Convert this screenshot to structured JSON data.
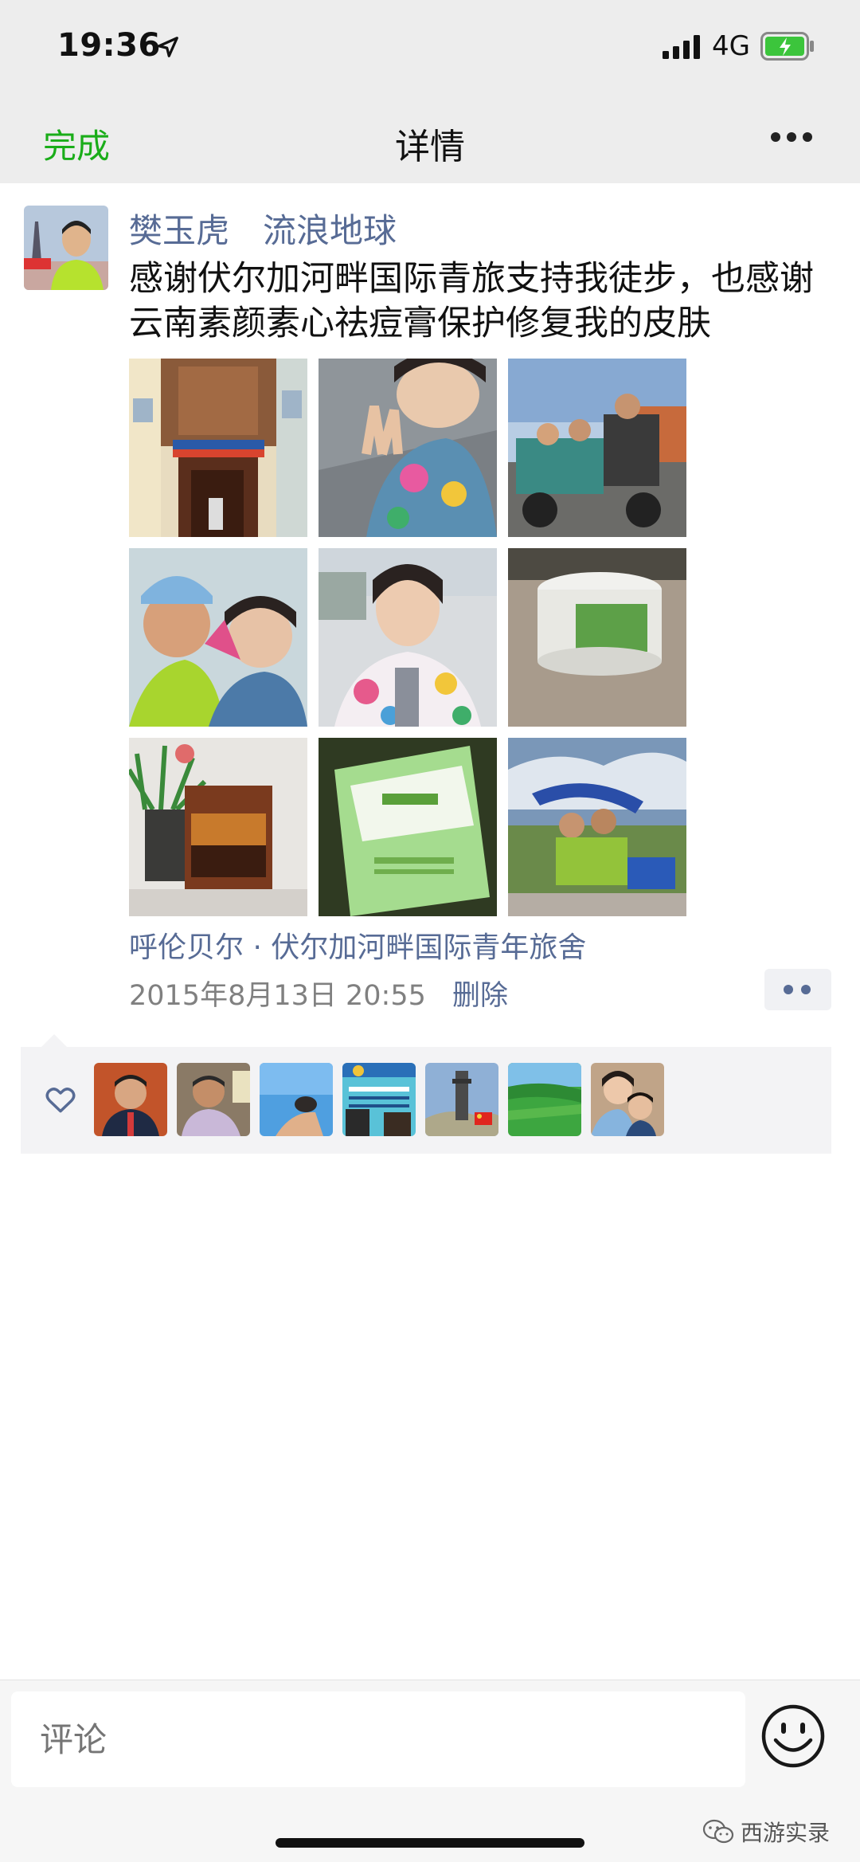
{
  "status_bar": {
    "time": "19:36",
    "network": "4G",
    "battery_color": "#3cc53c"
  },
  "nav": {
    "done_label": "完成",
    "title": "详情",
    "more_icon": "more-icon"
  },
  "post": {
    "author": "樊玉虎　流浪地球",
    "text": "感谢伏尔加河畔国际青旅支持我徒步，也感谢云南素颜素心祛痘膏保护修复我的皮肤",
    "location": "呼伦贝尔 · 伏尔加河畔国际青年旅舍",
    "time": "2015年8月13日 20:55",
    "delete_label": "删除",
    "photo_count": 9,
    "like_count": 7
  },
  "comment_bar": {
    "placeholder": "评论",
    "emoji_icon": "emoji-icon"
  },
  "watermark": {
    "text": "西游实录"
  },
  "colors": {
    "accent_green": "#1aad19",
    "link_blue": "#576b95",
    "nav_bg": "#ededed"
  }
}
